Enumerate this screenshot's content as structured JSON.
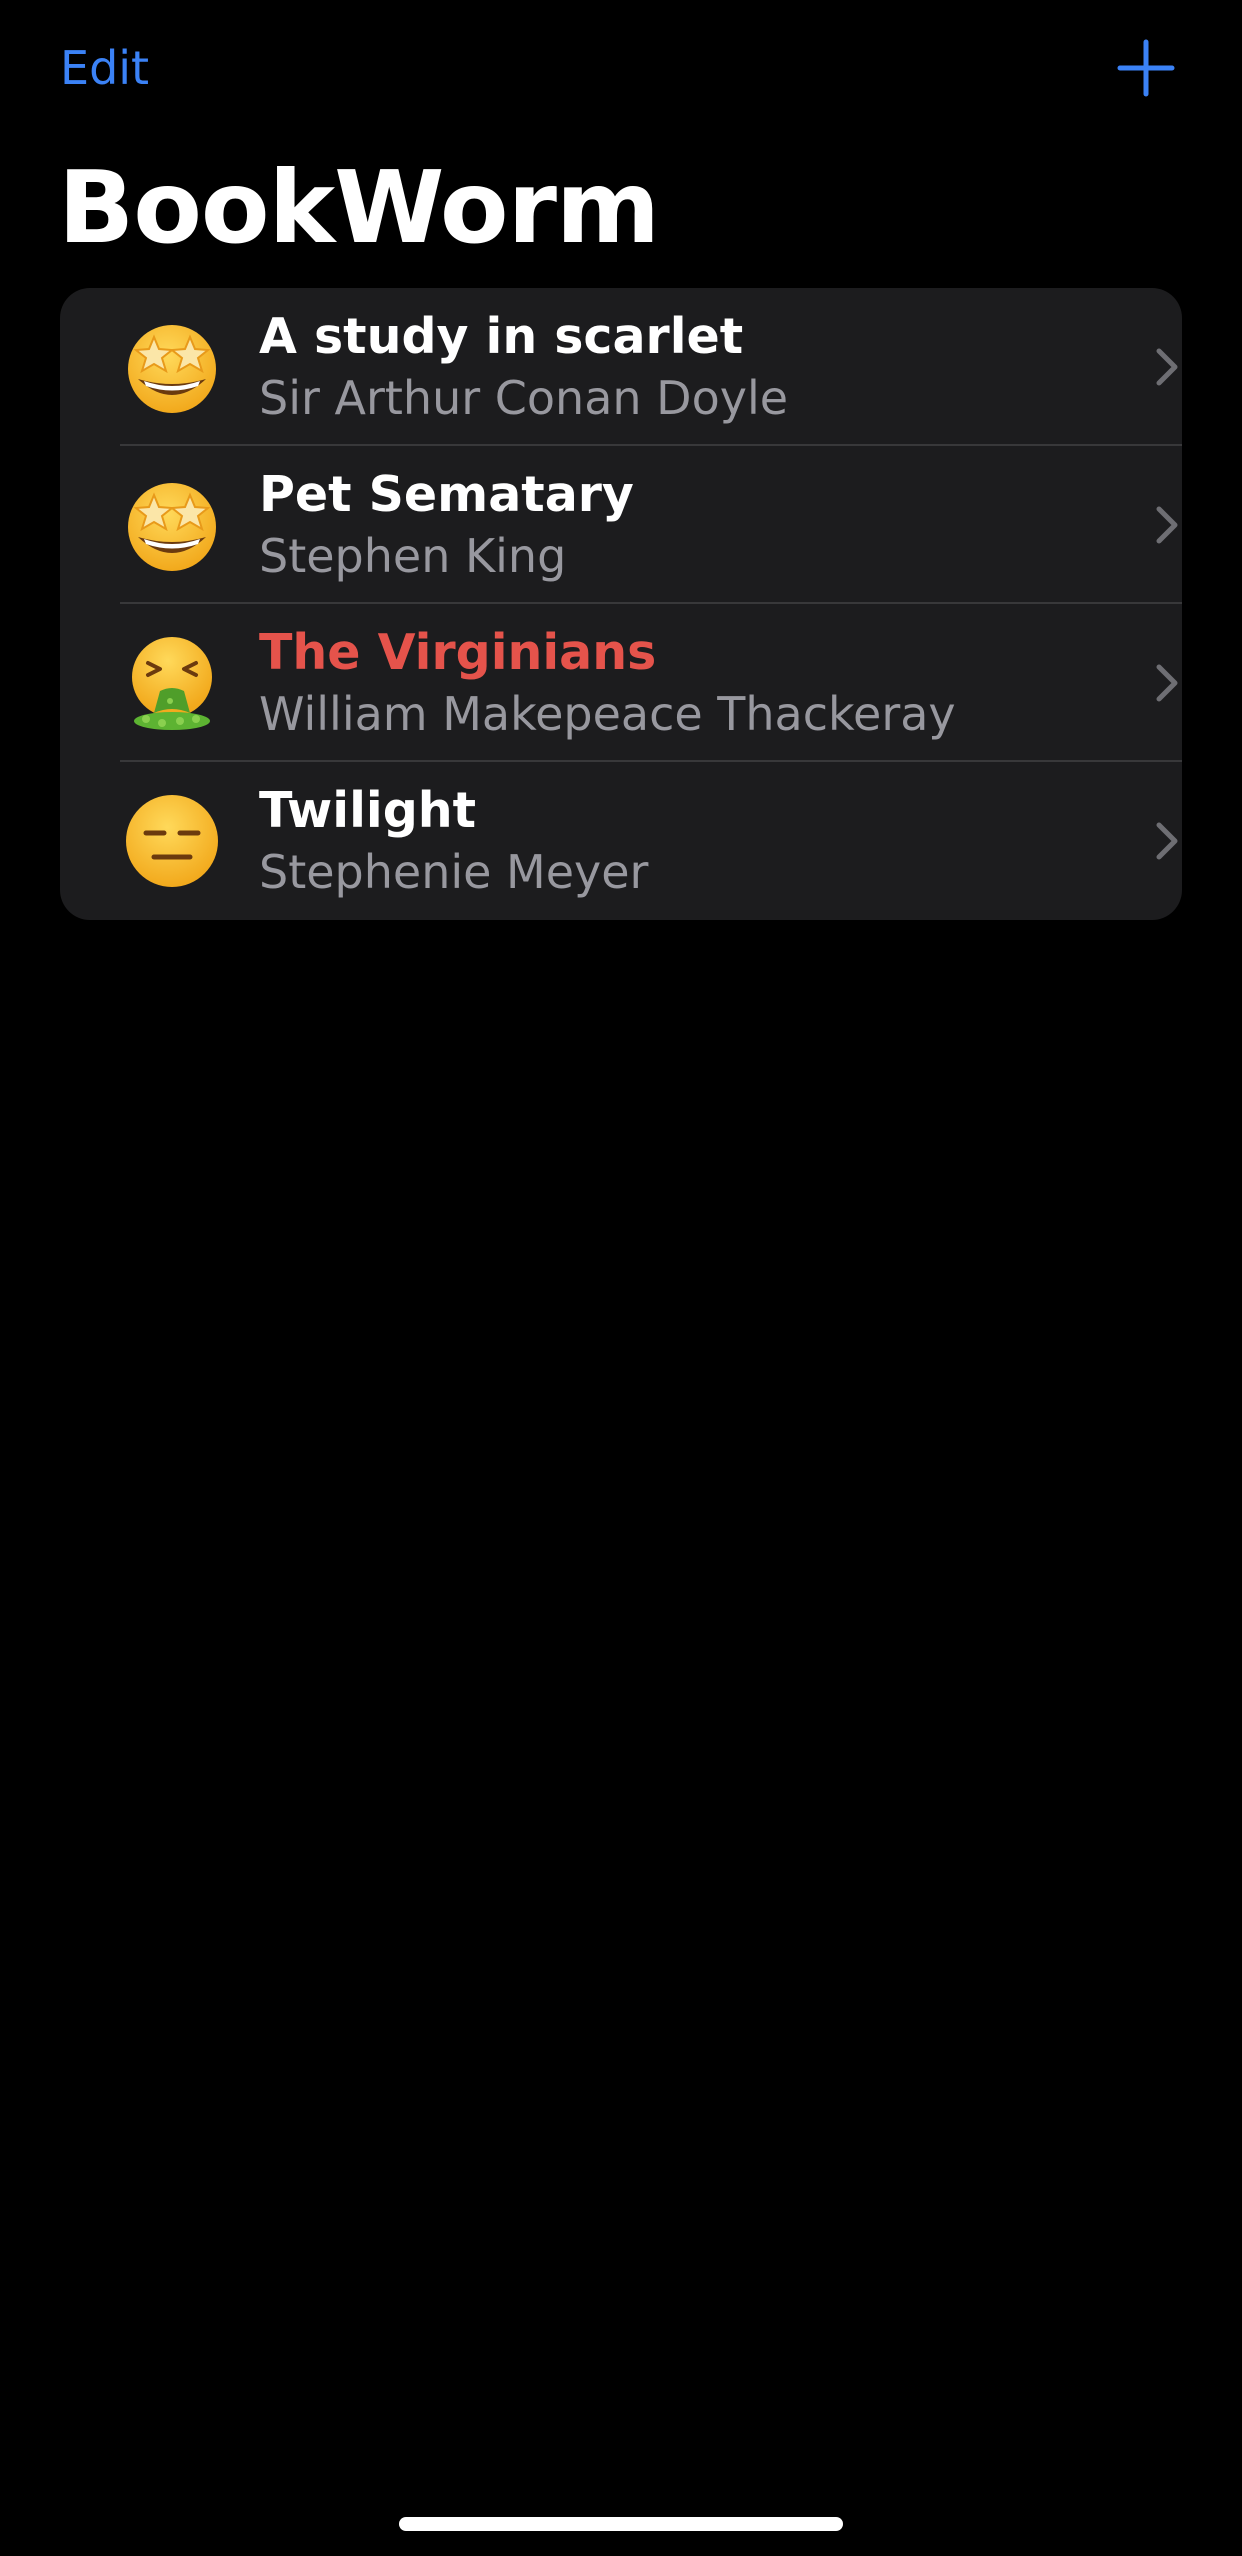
{
  "nav": {
    "edit_label": "Edit",
    "add_icon": "plus-icon",
    "accent_color": "#3b82f6"
  },
  "header": {
    "title": "BookWorm"
  },
  "books": [
    {
      "title": "A study in scarlet",
      "author": "Sir Arthur Conan Doyle",
      "rating_emoji": "star-struck-face",
      "title_color": "#ffffff"
    },
    {
      "title": "Pet Sematary",
      "author": "Stephen King",
      "rating_emoji": "star-struck-face",
      "title_color": "#ffffff"
    },
    {
      "title": "The Virginians",
      "author": "William Makepeace Thackeray",
      "rating_emoji": "vomiting-face",
      "title_color": "#e5534b"
    },
    {
      "title": "Twilight",
      "author": "Stephenie Meyer",
      "rating_emoji": "expressionless-face",
      "title_color": "#ffffff"
    }
  ],
  "colors": {
    "background": "#000000",
    "list_background": "#1c1c1e",
    "secondary_text": "#98989f",
    "low_rating": "#e5534b"
  }
}
